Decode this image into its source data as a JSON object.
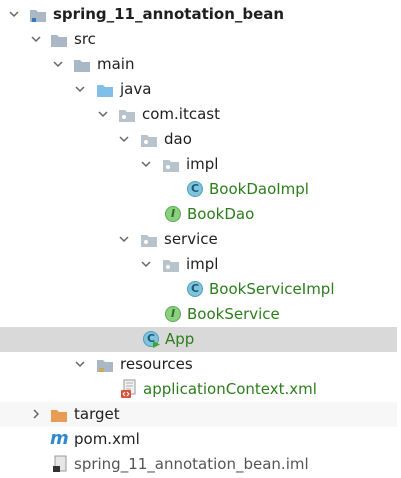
{
  "tree": {
    "project": "spring_11_annotation_bean",
    "src": "src",
    "main": "main",
    "java": "java",
    "package": "com.itcast",
    "dao": "dao",
    "dao_impl": "impl",
    "book_dao_impl": "BookDaoImpl",
    "book_dao": "BookDao",
    "service": "service",
    "service_impl": "impl",
    "book_service_impl": "BookServiceImpl",
    "book_service": "BookService",
    "app": "App",
    "resources": "resources",
    "app_context": "applicationContext.xml",
    "target": "target",
    "pom": "pom.xml",
    "iml": "spring_11_annotation_bean.iml"
  },
  "icons": {
    "class_letter": "C",
    "interface_letter": "I",
    "maven_letter": "m"
  },
  "colors": {
    "folder": "#a9b8c4",
    "source_folder": "#7fbfe8",
    "target_folder": "#e89d55",
    "selection": "#d9d9d9",
    "green_text": "#2c7d1c"
  }
}
